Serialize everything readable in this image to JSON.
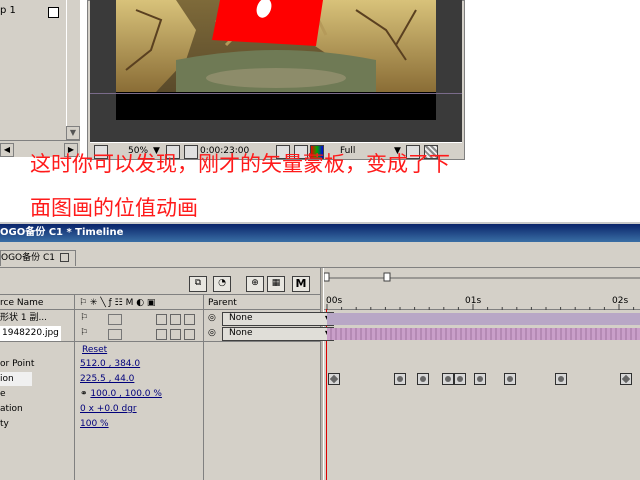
{
  "project": {
    "item_label": "p 1"
  },
  "composition": {
    "zoom": "50%",
    "timecode": "0:00:23:00",
    "resolution": "Full"
  },
  "caption": {
    "line1": "这时你可以发现，刚才的矢量蒙板，变成了下",
    "line2": "面图画的位值动画"
  },
  "timeline": {
    "window_title": "OGO备份 C1 * Timeline",
    "tab_label": "OGO备份 C1",
    "columns": {
      "source_name": "rce Name",
      "parent": "Parent",
      "m_label": "M"
    },
    "ruler": {
      "labels": [
        "00s",
        "01s",
        "02s"
      ]
    },
    "layers": [
      {
        "name": "形状 1 副...",
        "parent": "None"
      },
      {
        "name": "1948220.jpg",
        "parent": "None"
      }
    ],
    "transform": {
      "reset_label": "Reset",
      "properties": [
        {
          "name": "or Point",
          "value": "512.0 , 384.0"
        },
        {
          "name": "ion",
          "value": "225.5 , 44.0"
        },
        {
          "name": "e",
          "value": "100.0 , 100.0 %"
        },
        {
          "name": "ation",
          "value": "0 x +0.0 dgr"
        },
        {
          "name": "ty",
          "value": "100 %"
        }
      ]
    },
    "keyframes_seconds": [
      0.05,
      0.5,
      0.66,
      0.83,
      0.91,
      1.05,
      1.25,
      1.6,
      2.05
    ]
  },
  "colors": {
    "caption": "#ff1a1a",
    "title_bar": "#0a246a",
    "shape_layer_bar": "#b8a7c6",
    "image_layer_bar": "#c99fc9",
    "value_link": "#00007b"
  }
}
